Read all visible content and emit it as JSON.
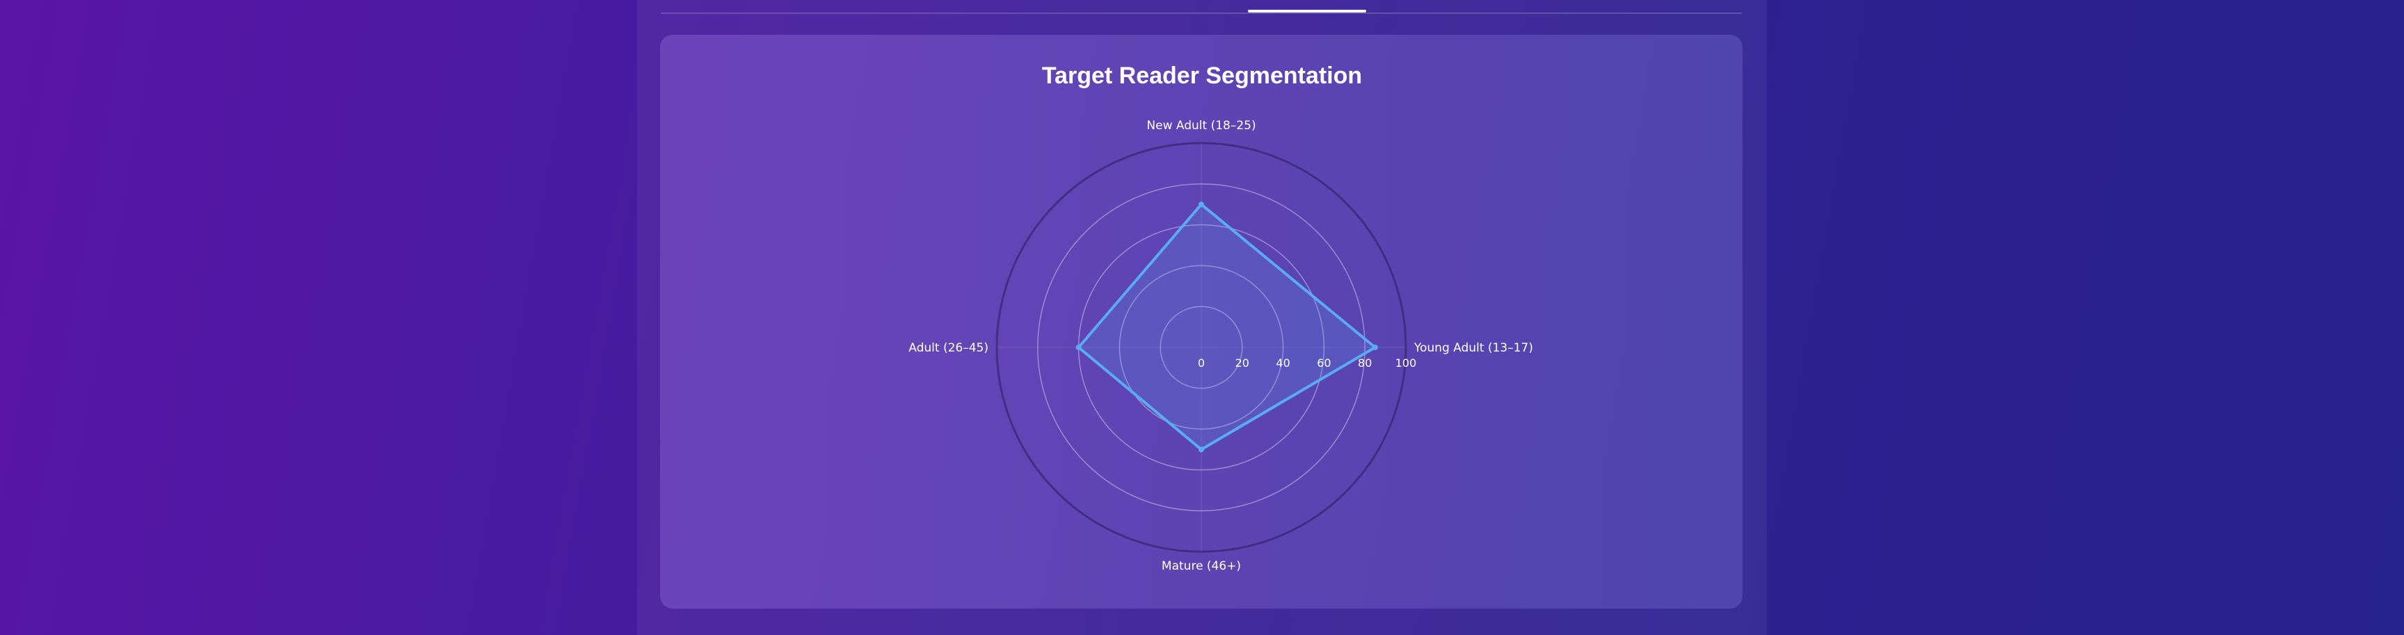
{
  "colors": {
    "series_stroke": "#5aaaf5",
    "series_fill": "rgba(90,170,245,0.18)",
    "grid": "rgba(255,255,255,0.38)",
    "outer_ring": "rgba(40,30,90,0.55)"
  },
  "chart_data": {
    "type": "radar",
    "title": "Target Reader Segmentation",
    "axes": [
      "Young Adult (13–17)",
      "New Adult (18–25)",
      "Adult (26–45)",
      "Mature (46+)"
    ],
    "series": [
      {
        "values": [
          85,
          70,
          60,
          50
        ]
      }
    ],
    "range": [
      0,
      100
    ],
    "ticks": [
      "0",
      "20",
      "40",
      "60",
      "80",
      "100"
    ],
    "tick_values": [
      0,
      20,
      40,
      60,
      80,
      100
    ],
    "grid": true,
    "legend": "none"
  }
}
